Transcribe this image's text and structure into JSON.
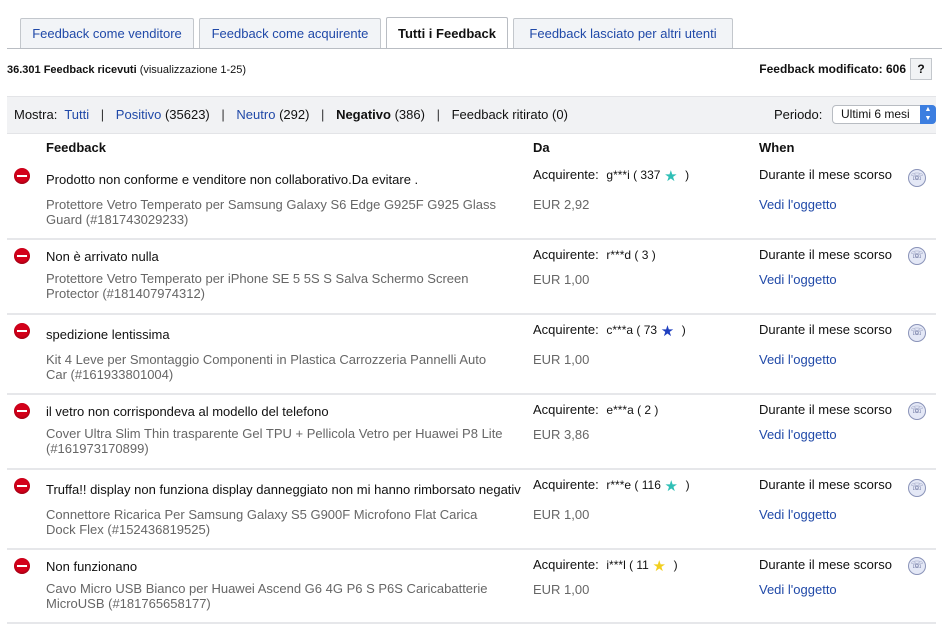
{
  "tabs": [
    {
      "label": "Feedback come venditore"
    },
    {
      "label": "Feedback come acquirente"
    },
    {
      "label": "Tutti i Feedback"
    },
    {
      "label": "Feedback lasciato per altri utenti"
    }
  ],
  "summary": {
    "count": "36.301 Feedback ricevuti",
    "range": "(visualizzazione 1-25)",
    "modified": "Feedback modificato: 606",
    "help": "?"
  },
  "filter": {
    "show_label": "Mostra:",
    "all": "Tutti",
    "positive": "Positivo",
    "positive_count": "(35623)",
    "neutral": "Neutro",
    "neutral_count": "(292)",
    "negative": "Negativo",
    "negative_count": "(386)",
    "withdrawn": "Feedback ritirato (0)",
    "sep": "|",
    "period_label": "Periodo:",
    "period_value": "Ultimi 6 mesi"
  },
  "columns": {
    "feedback": "Feedback",
    "from": "Da",
    "when": "When"
  },
  "rows": [
    {
      "text": "Prodotto non conforme e venditore non collaborativo.Da evitare .",
      "item": "Protettore Vetro Temperato per Samsung Galaxy S6 Edge G925F G925 Glass Guard (#181743029233)",
      "role": "Acquirente:",
      "user": "g***i ( 337",
      "star": "★",
      "star_color": "#2fbfb6",
      "user_close": ")",
      "price": "EUR 2,92",
      "when": "Durante il mese scorso",
      "link": "Vedi l'oggetto"
    },
    {
      "text": "Non è arrivato nulla",
      "item": "Protettore Vetro Temperato per iPhone SE 5 5S S Salva Schermo Screen Protector (#181407974312)",
      "role": "Acquirente:",
      "user": "r***d ( 3 )",
      "star": "",
      "star_color": "",
      "user_close": "",
      "price": "EUR 1,00",
      "when": "Durante il mese scorso",
      "link": "Vedi l'oggetto"
    },
    {
      "text": "spedizione lentissima",
      "item": "Kit 4 Leve per Smontaggio Componenti in Plastica Carrozzeria Pannelli Auto Car (#161933801004)",
      "role": "Acquirente:",
      "user": "c***a ( 73",
      "star": "★",
      "star_color": "#1f3fbf",
      "user_close": ")",
      "price": "EUR 1,00",
      "when": "Durante il mese scorso",
      "link": "Vedi l'oggetto"
    },
    {
      "text": "il vetro non corrispondeva al modello del telefono",
      "item": "Cover Ultra Slim Thin trasparente Gel TPU + Pellicola Vetro per Huawei P8 Lite (#161973170899)",
      "role": "Acquirente:",
      "user": "e***a ( 2 )",
      "star": "",
      "star_color": "",
      "user_close": "",
      "price": "EUR 3,86",
      "when": "Durante il mese scorso",
      "link": "Vedi l'oggetto"
    },
    {
      "text": "Truffa!! display non funziona display danneggiato non mi hanno rimborsato negativ",
      "item": "Connettore Ricarica Per Samsung Galaxy S5 G900F Microfono Flat Carica Dock Flex (#152436819525)",
      "role": "Acquirente:",
      "user": "r***e ( 116",
      "star": "★",
      "star_color": "#2fbfb6",
      "user_close": ")",
      "price": "EUR 1,00",
      "when": "Durante il mese scorso",
      "link": "Vedi l'oggetto"
    },
    {
      "text": "Non funzionano",
      "item": "Cavo Micro USB Bianco per Huawei Ascend G6 4G P6 S P6S Caricabatterie MicroUSB (#181765658177)",
      "role": "Acquirente:",
      "user": "i***l ( 11",
      "star": "★",
      "star_color": "#f2cf1f",
      "user_close": ")",
      "price": "EUR 1,00",
      "when": "Durante il mese scorso",
      "link": "Vedi l'oggetto"
    }
  ],
  "icons": {
    "negative": "negative-rating-icon",
    "reply": "reply-feedback-icon",
    "caret": "chevron-updown-icon"
  },
  "colors": {
    "link": "#2049a8",
    "negative": "#d3001a",
    "filterbar": "#f1f2f4"
  }
}
